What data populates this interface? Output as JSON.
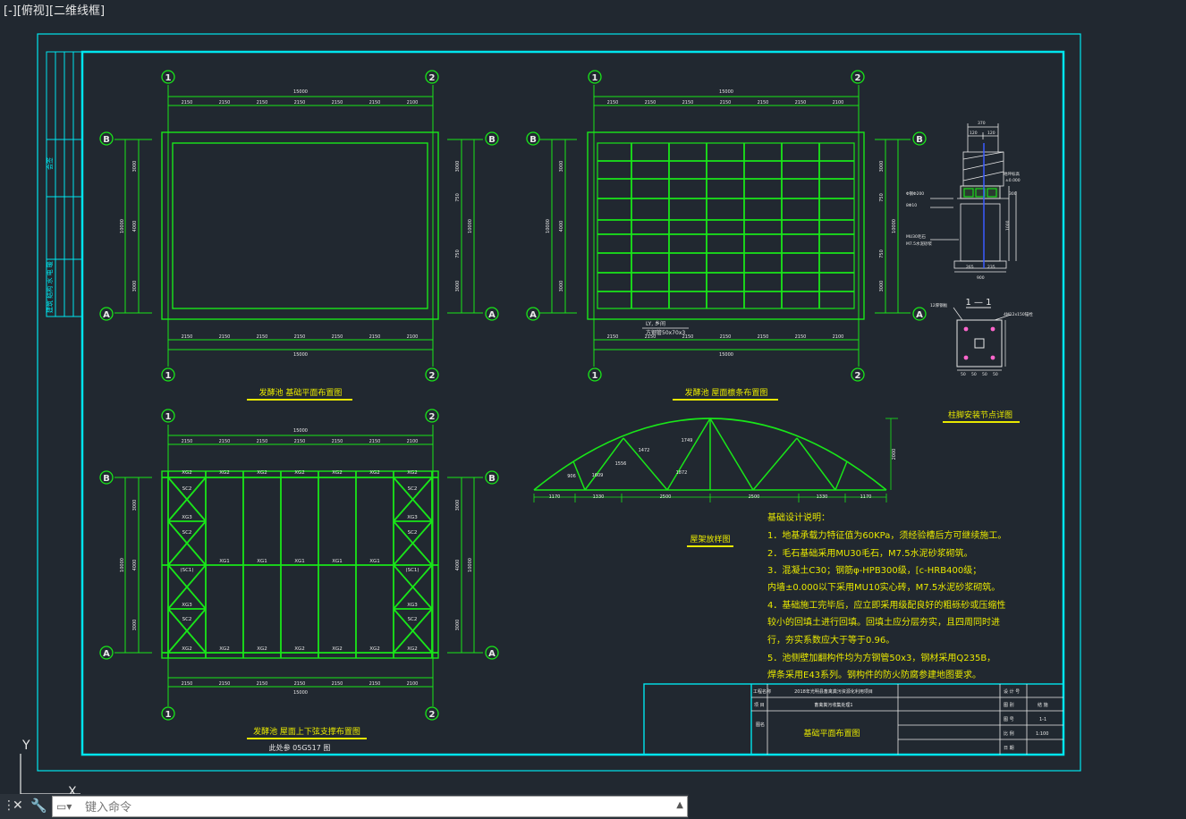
{
  "viewport": {
    "label": "[-][俯视][二维线框]"
  },
  "colors": {
    "bg": "#212830",
    "frame": "#00e5ee",
    "green": "#19e619",
    "white": "#e8e8e8",
    "yellow": "#e8e800",
    "blue": "#3a5bff"
  },
  "grid": {
    "axis1": "1",
    "axis2": "2",
    "axisB": "B",
    "axisA": "A"
  },
  "dims": {
    "total": "15000",
    "spans": [
      "2150",
      "2150",
      "2150",
      "2150",
      "2150",
      "2150",
      "2100"
    ],
    "height_total": "10000",
    "vert_parts": [
      "3000",
      "4000",
      "3000"
    ],
    "right_parts": [
      "3000",
      "750",
      "750",
      "3000"
    ]
  },
  "plan1": {
    "title": "发酵池 基础平面布置图"
  },
  "plan2": {
    "title": "发酵池 屋面檩条布置图",
    "note1": "LY, 乡间",
    "note2": "方钢管50x70x3"
  },
  "plan3": {
    "title": "发酵池 屋面上下弦支撑布置图",
    "subtitle": "此处参 05G517 图",
    "labels": {
      "xg1": "XG1",
      "xg2": "XG2",
      "xg3": "XG3",
      "sc2": "SC2",
      "sc1": "(SC1)"
    }
  },
  "truss": {
    "title": "屋架放样图",
    "bottom_dims": [
      "1170",
      "1330",
      "2500",
      "2500",
      "1330",
      "1170"
    ],
    "member_lengths": [
      "906",
      "1609",
      "1556",
      "1472",
      "1749",
      "1872"
    ],
    "height_dim": "2000"
  },
  "detail": {
    "title": "柱脚安装节点详图",
    "section_label": "1 — 1",
    "top_dim": "370",
    "sub_dims": [
      "120",
      "120"
    ],
    "side_note": "地坪标高",
    "level": "±0.000",
    "pipe": "Φ钢Φ200",
    "rebar": "8Φ10",
    "material1": "MU30毛石",
    "material2": "M7.5水泥砂浆",
    "dim_bottom": [
      "265",
      "235"
    ],
    "width": "900",
    "right_dims": [
      "300",
      "1000"
    ],
    "plate_note": "4M12x150锚栓",
    "plate_left": "12厚钢板",
    "plate_dims": [
      "50",
      "50",
      "50",
      "50"
    ]
  },
  "notes": {
    "title": "基础设计说明：",
    "lines": [
      "1．地基承载力特征值为60KPa，须经验槽后方可继续施工。",
      "2．毛石基础采用MU30毛石，M7.5水泥砂浆砌筑。",
      "3．混凝土C30；钢筋φ-HPB300级，[c-HRB400级；",
      "内墙±0.000以下采用MU10实心砖，M7.5水泥砂浆砌筑。",
      "4．基础施工完毕后，应立即采用级配良好的粗砾砂或压缩性",
      "较小的回填土进行回填。回填土应分层夯实，且四周同时进",
      "行，夯实系数应大于等于0.96。",
      "5．池侧壁加翻构件均为方钢管50x3，钢材采用Q235B，",
      "焊条采用E43系列。钢构件的防火防腐参建地图要求。"
    ]
  },
  "titleblock": {
    "project_label": "工程名称",
    "project": "2018年光明县畜禽粪污资源化利用项目",
    "item_label": "项 目",
    "item": "畜禽粪污收集处理1",
    "drawing_label": "图名",
    "drawing": "基础平面布置图",
    "designer": "设 计 号",
    "category_label": "图 别",
    "category": "结 施",
    "number_label": "图 号",
    "number": "1-1",
    "scale_label": "比 例",
    "scale": "1:100",
    "date_label": "日 期"
  },
  "sidestrip": {
    "top": "会签",
    "bottom": "建筑 结构 水 电 暖"
  },
  "ucs": {
    "y": "Y",
    "x": "X"
  },
  "cmd": {
    "placeholder": "键入命令",
    "grip": "⋮",
    "close": "✕",
    "wrench": "🔧",
    "prompt_icon": "▭▾",
    "scroll": "▲"
  }
}
